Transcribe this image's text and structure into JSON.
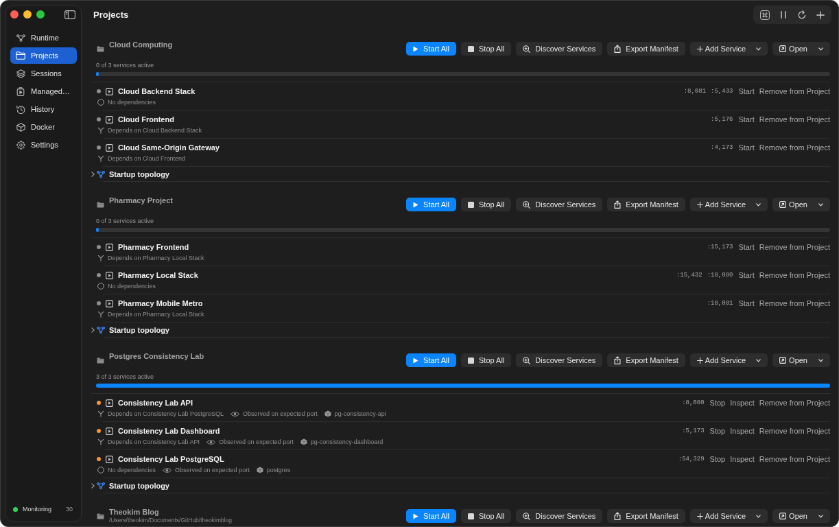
{
  "sidebar": {
    "items": [
      {
        "label": "Runtime",
        "selected": false
      },
      {
        "label": "Projects",
        "selected": true
      },
      {
        "label": "Sessions",
        "selected": false
      },
      {
        "label": "Managed…",
        "selected": false
      },
      {
        "label": "History",
        "selected": false
      },
      {
        "label": "Docker",
        "selected": false
      },
      {
        "label": "Settings",
        "selected": false
      }
    ],
    "footer": {
      "label": "Monitoring",
      "count": "30",
      "on": true
    }
  },
  "window": {
    "title": "Projects"
  },
  "projects": [
    {
      "name": "Cloud Computing",
      "buttons": [
        {
          "kind": "start",
          "label": "Start All"
        },
        {
          "kind": "stop",
          "label": "Stop All"
        },
        {
          "kind": "discover",
          "label": "Discover Services"
        },
        {
          "kind": "export",
          "label": "Export Manifest"
        },
        {
          "kind": "add",
          "label": "Add Service"
        },
        {
          "kind": "open",
          "label": "Open"
        }
      ],
      "status_text": "0 of 3 services active",
      "level": 0,
      "services": [
        {
          "name": "Cloud Backend Stack",
          "color": "#8e8e8e",
          "details": [
            {
              "kind": "none",
              "text": "No dependencies"
            }
          ],
          "ports": [
            ":8,081",
            ":5,433"
          ],
          "actions": [
            "Start",
            "Remove from Project"
          ]
        },
        {
          "name": "Cloud Frontend",
          "color": "#8e8e8e",
          "details": [
            {
              "kind": "depends",
              "text": "Depends on Cloud Backend Stack"
            }
          ],
          "ports": [
            ":5,176"
          ],
          "actions": [
            "Start",
            "Remove from Project"
          ]
        },
        {
          "name": "Cloud Same-Origin Gateway",
          "color": "#8e8e8e",
          "details": [
            {
              "kind": "depends",
              "text": "Depends on Cloud Frontend"
            }
          ],
          "ports": [
            ":4,173"
          ],
          "actions": [
            "Start",
            "Remove from Project"
          ]
        }
      ],
      "topology": {
        "label": "Startup topology",
        "expanded": false
      }
    },
    {
      "name": "Pharmacy Project",
      "buttons": [
        {
          "kind": "start",
          "label": "Start All"
        },
        {
          "kind": "stop",
          "label": "Stop All"
        },
        {
          "kind": "discover",
          "label": "Discover Services"
        },
        {
          "kind": "export",
          "label": "Export Manifest"
        },
        {
          "kind": "add",
          "label": "Add Service"
        },
        {
          "kind": "open",
          "label": "Open"
        }
      ],
      "status_text": "0 of 3 services active",
      "level": 0,
      "services": [
        {
          "name": "Pharmacy Frontend",
          "color": "#8e8e8e",
          "details": [
            {
              "kind": "depends",
              "text": "Depends on Pharmacy Local Stack"
            }
          ],
          "ports": [
            ":15,173"
          ],
          "actions": [
            "Start",
            "Remove from Project"
          ]
        },
        {
          "name": "Pharmacy Local Stack",
          "color": "#8e8e8e",
          "details": [
            {
              "kind": "none",
              "text": "No dependencies"
            }
          ],
          "ports": [
            ":15,432",
            ":18,080"
          ],
          "actions": [
            "Start",
            "Remove from Project"
          ]
        },
        {
          "name": "Pharmacy Mobile Metro",
          "color": "#8e8e8e",
          "details": [
            {
              "kind": "depends",
              "text": "Depends on Pharmacy Local Stack"
            }
          ],
          "ports": [
            ":18,081"
          ],
          "actions": [
            "Start",
            "Remove from Project"
          ]
        }
      ],
      "topology": {
        "label": "Startup topology",
        "expanded": false
      }
    },
    {
      "name": "Postgres Consistency Lab",
      "buttons": [
        {
          "kind": "start",
          "label": "Start All"
        },
        {
          "kind": "stop",
          "label": "Stop All"
        },
        {
          "kind": "discover",
          "label": "Discover Services"
        },
        {
          "kind": "export",
          "label": "Export Manifest"
        },
        {
          "kind": "add",
          "label": "Add Service"
        },
        {
          "kind": "open",
          "label": "Open"
        }
      ],
      "status_text": "3 of 3 services active",
      "level": 1,
      "services": [
        {
          "name": "Consistency Lab API",
          "color": "#f7943a",
          "details": [
            {
              "kind": "depends",
              "text": "Depends on Consistency Lab PostgreSQL"
            },
            {
              "kind": "observed",
              "text": "Observed on expected port"
            },
            {
              "kind": "container",
              "text": "pg-consistency-api"
            }
          ],
          "ports": [
            ":8,080"
          ],
          "actions": [
            "Stop",
            "Inspect",
            "Remove from Project"
          ]
        },
        {
          "name": "Consistency Lab Dashboard",
          "color": "#f7943a",
          "details": [
            {
              "kind": "depends",
              "text": "Depends on Consistency Lab API"
            },
            {
              "kind": "observed",
              "text": "Observed on expected port"
            },
            {
              "kind": "container",
              "text": "pg-consistency-dashboard"
            }
          ],
          "ports": [
            ":5,173"
          ],
          "actions": [
            "Stop",
            "Inspect",
            "Remove from Project"
          ]
        },
        {
          "name": "Consistency Lab PostgreSQL",
          "color": "#f7943a",
          "details": [
            {
              "kind": "none",
              "text": "No dependencies"
            },
            {
              "kind": "observed",
              "text": "Observed on expected port"
            },
            {
              "kind": "container",
              "text": "postgres"
            }
          ],
          "ports": [
            ":54,329"
          ],
          "actions": [
            "Stop",
            "Inspect",
            "Remove from Project"
          ]
        }
      ],
      "topology": {
        "label": "Startup topology",
        "expanded": false
      }
    },
    {
      "name": "Theokim Blog",
      "path": "/Users/theokim/Documents/GitHub/theokimblog",
      "buttons": [
        {
          "kind": "start",
          "label": "Start All"
        },
        {
          "kind": "stop",
          "label": "Stop All"
        },
        {
          "kind": "discover",
          "label": "Discover Services"
        },
        {
          "kind": "export",
          "label": "Export Manifest"
        },
        {
          "kind": "add",
          "label": "Add Service"
        },
        {
          "kind": "open",
          "label": "Open"
        }
      ]
    }
  ]
}
